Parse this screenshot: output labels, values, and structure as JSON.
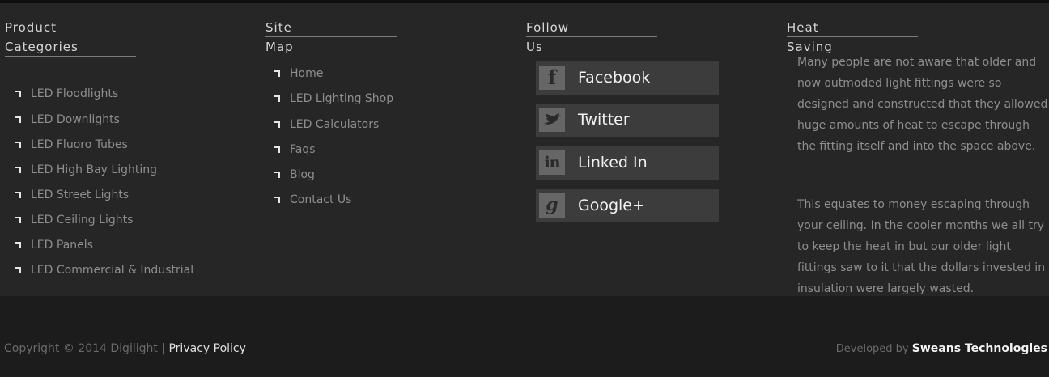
{
  "product_categories": {
    "title_line1": "Product",
    "title_line2": "Categories",
    "items": [
      "LED Floodlights",
      "LED Downlights",
      "LED Fluoro Tubes",
      "LED High Bay Lighting",
      "LED Street Lights",
      "LED Ceiling Lights",
      "LED Panels",
      "LED Commercial & Industrial"
    ]
  },
  "site_map": {
    "title": "Site Map",
    "items": [
      "Home",
      "LED Lighting Shop",
      "LED Calculators",
      "Faqs",
      "Blog",
      "Contact Us"
    ]
  },
  "follow_us": {
    "title": "Follow Us",
    "items": [
      {
        "label": "Facebook",
        "icon": "facebook-icon",
        "glyph": "f"
      },
      {
        "label": "Twitter",
        "icon": "twitter-icon",
        "glyph": "🐦"
      },
      {
        "label": "Linked In",
        "icon": "linkedin-icon",
        "glyph": "in"
      },
      {
        "label": "Google+",
        "icon": "google-plus-icon",
        "glyph": "g"
      }
    ]
  },
  "heat_saving": {
    "title": "Heat Saving",
    "paragraph1": "Many people are not aware that older and now outmoded light fittings were so designed and constructed that they allowed huge amounts of heat to escape through the fitting itself and into the space above.",
    "paragraph2": "This equates to money escaping through your ceiling. In the cooler months we all try to keep the heat in but our older light fittings saw to it that the dollars invested in insulation were largely wasted."
  },
  "bottom_bar": {
    "copyright": "Copyright © 2014 Digilight | ",
    "privacy_link": "Privacy Policy",
    "developed_by": "Developed by ",
    "developer_link": "Sweans Technologies"
  },
  "colors": {
    "footer_bg": "#262626",
    "bottom_bg": "#1c1c1c",
    "social_button_bg": "#3c3c3c",
    "icon_bg": "#666666"
  }
}
